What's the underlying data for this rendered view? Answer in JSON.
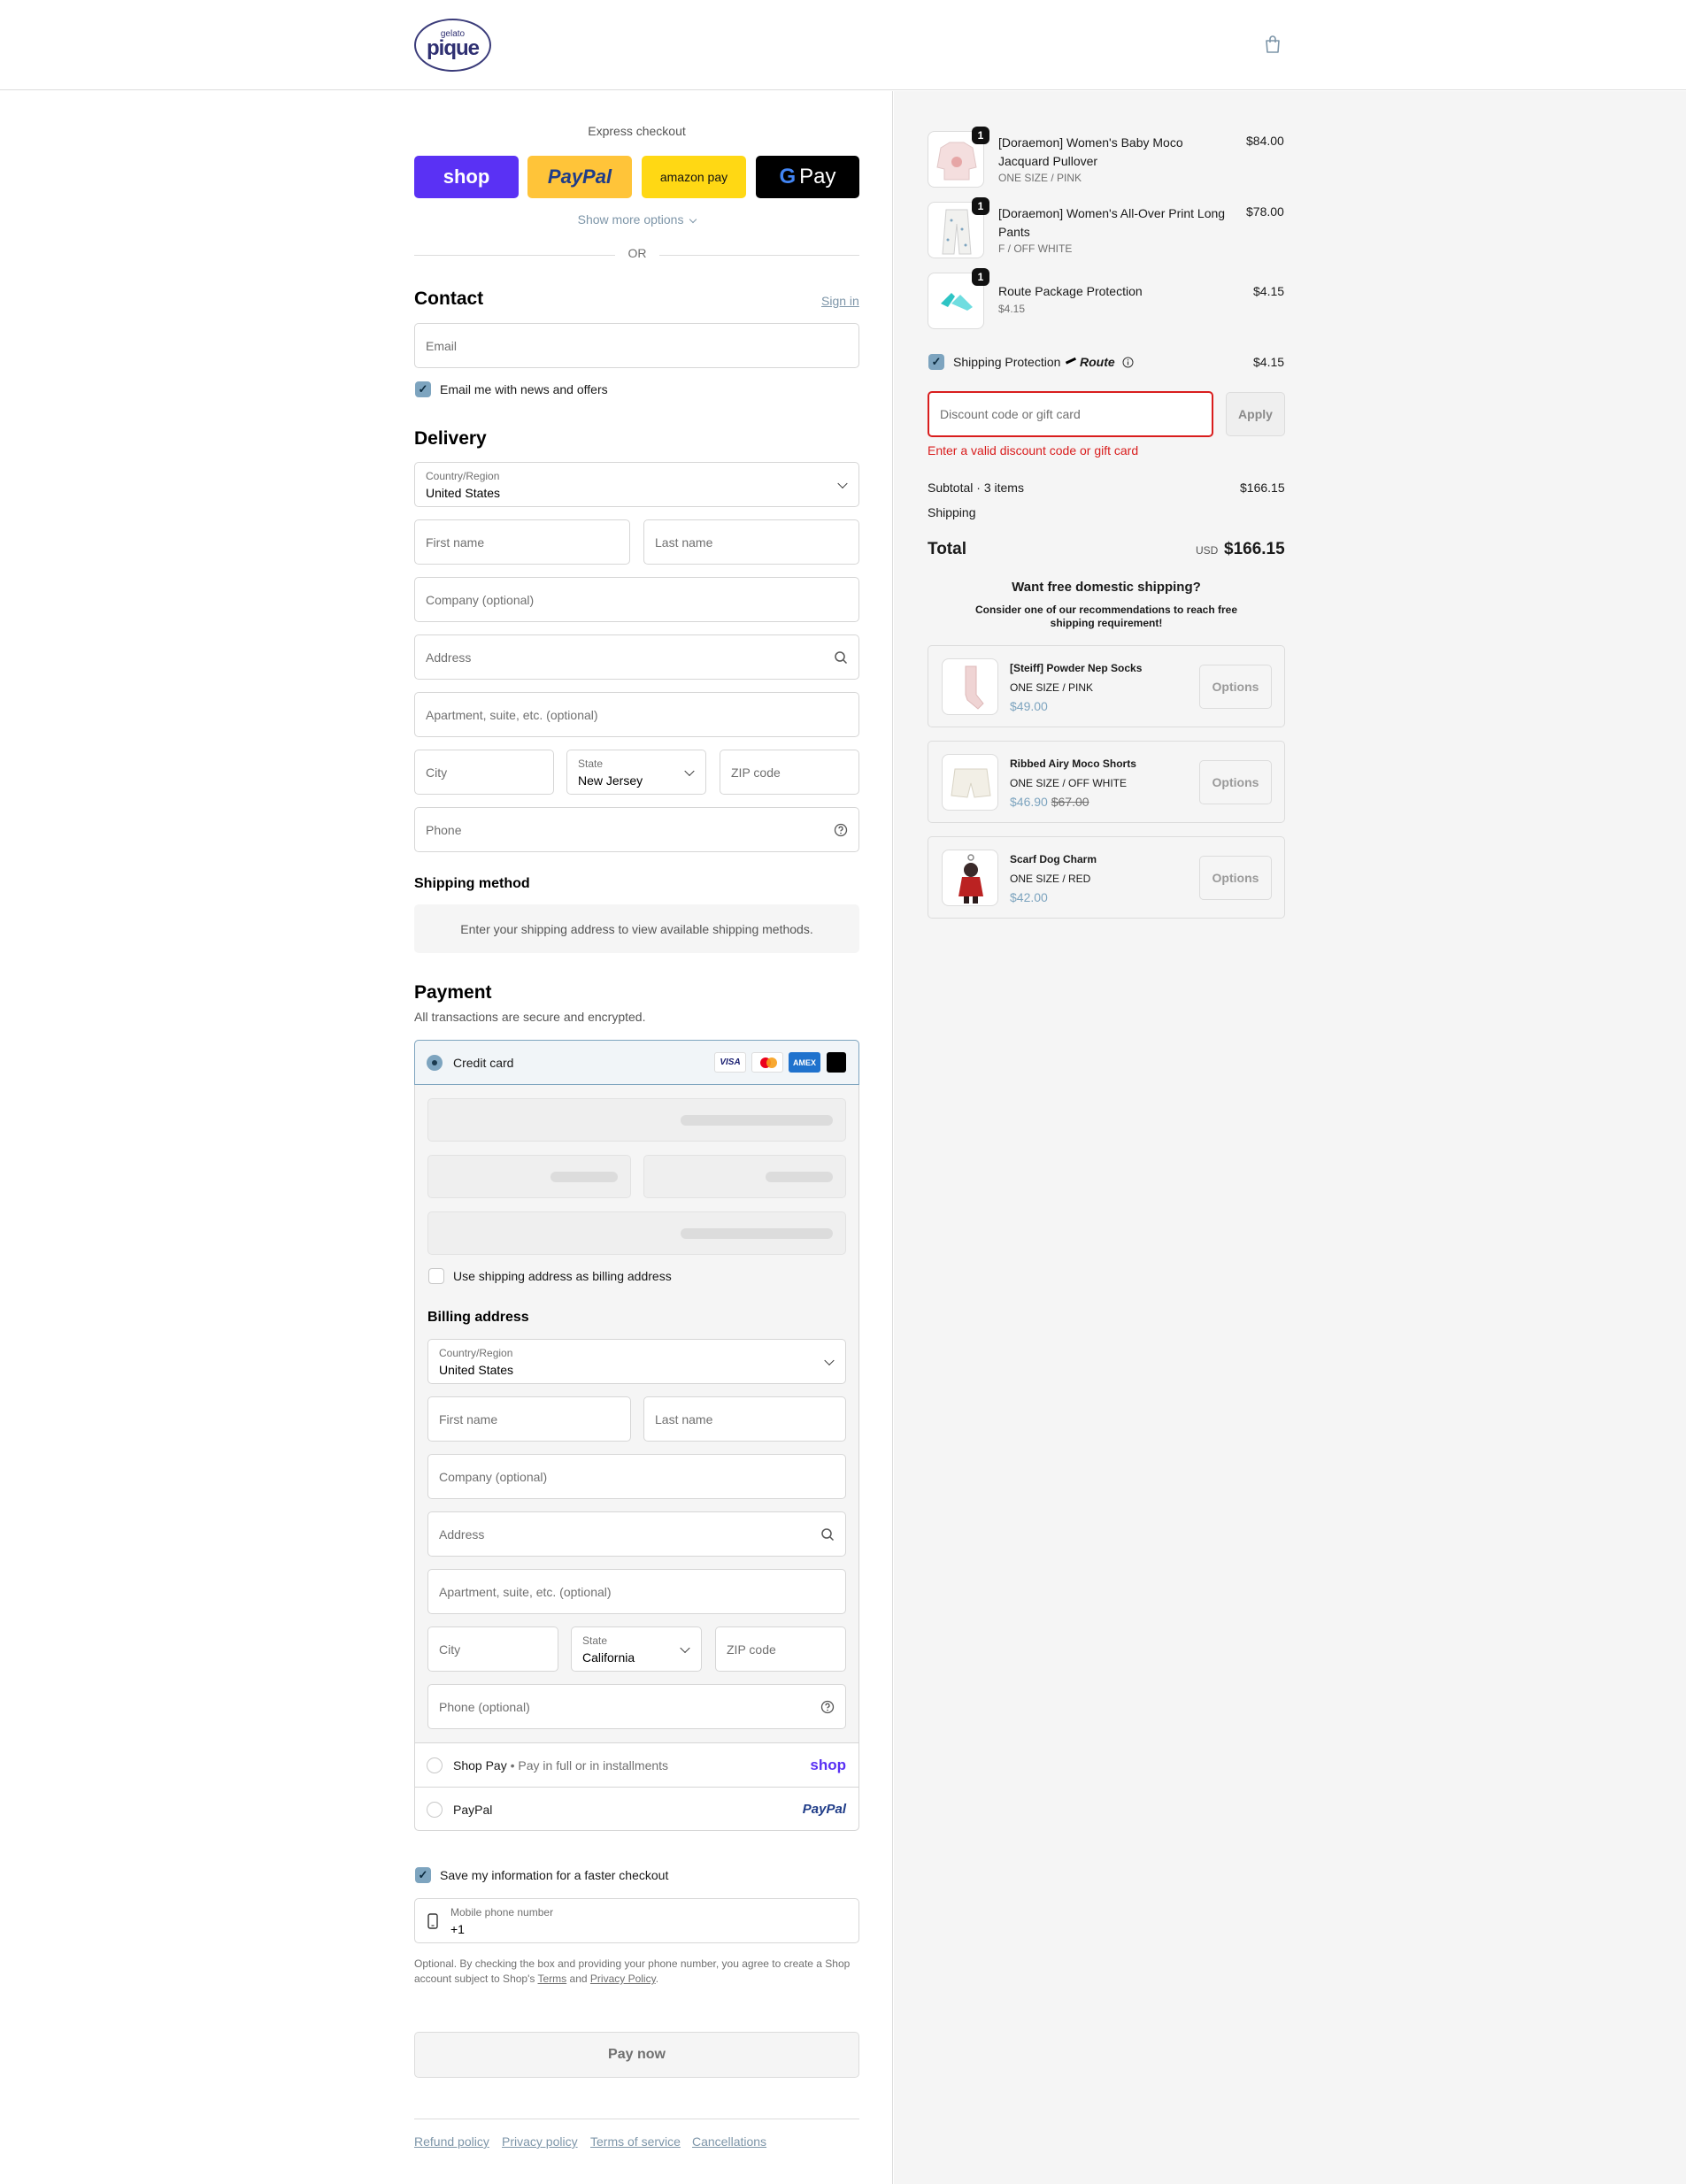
{
  "brand": {
    "logo_small": "gelato",
    "logo_big": "pique"
  },
  "express": {
    "title": "Express checkout",
    "shop": "shop",
    "paypal": "PayPal",
    "amazon": "amazon pay",
    "gpay": "Pay",
    "show_more": "Show more options",
    "or": "OR"
  },
  "contact": {
    "title": "Contact",
    "sign_in": "Sign in",
    "email_placeholder": "Email",
    "news_label": "Email me with news and offers"
  },
  "delivery": {
    "title": "Delivery",
    "country_label": "Country/Region",
    "country_value": "United States",
    "first_name": "First name",
    "last_name": "Last name",
    "company": "Company (optional)",
    "address": "Address",
    "apartment": "Apartment, suite, etc. (optional)",
    "city": "City",
    "state_label": "State",
    "state_value": "New Jersey",
    "zip": "ZIP code",
    "phone": "Phone"
  },
  "shipping_method": {
    "title": "Shipping method",
    "message": "Enter your shipping address to view available shipping methods."
  },
  "payment": {
    "title": "Payment",
    "subtitle": "All transactions are secure and encrypted.",
    "credit_card": "Credit card",
    "visa": "VISA",
    "amex": "AMEX",
    "use_shipping": "Use shipping address as billing address",
    "billing_title": "Billing address",
    "country_label": "Country/Region",
    "country_value": "United States",
    "first_name": "First name",
    "last_name": "Last name",
    "company": "Company (optional)",
    "address": "Address",
    "apartment": "Apartment, suite, etc. (optional)",
    "city": "City",
    "state_label": "State",
    "state_value": "California",
    "zip": "ZIP code",
    "phone": "Phone (optional)",
    "shop_pay": "Shop Pay",
    "shop_pay_sub": "• Pay in full or in installments",
    "shop_logo": "shop",
    "paypal": "PayPal",
    "paypal_logo": "PayPal"
  },
  "save_info": {
    "label": "Save my information for a faster checkout",
    "mobile_label": "Mobile phone number",
    "mobile_value": "+1",
    "legal_1": "Optional. By checking the box and providing your phone number, you agree to create a Shop",
    "legal_2": "account subject to Shop's",
    "terms": "Terms",
    "and": "and",
    "privacy": "Privacy Policy",
    "period": "."
  },
  "pay_now": "Pay now",
  "footer_links": [
    "Refund policy",
    "Privacy policy",
    "Terms of service",
    "Cancellations"
  ],
  "cart": {
    "items": [
      {
        "qty": "1",
        "name_1": "[Doraemon] Women's Baby Moco",
        "name_2": "Jacquard Pullover",
        "variant": "ONE SIZE / PINK",
        "price": "$84.00"
      },
      {
        "qty": "1",
        "name_1": "[Doraemon] Women's All-Over Print Long",
        "name_2": "Pants",
        "variant": "F / OFF WHITE",
        "price": "$78.00"
      },
      {
        "qty": "1",
        "name_1": "Route Package Protection",
        "name_2": "",
        "variant": "$4.15",
        "price": "$4.15"
      }
    ],
    "shipping_protection": "Shipping Protection",
    "route_logo": "Route",
    "shipping_protection_price": "$4.15",
    "discount_placeholder": "Discount code or gift card",
    "apply": "Apply",
    "discount_error": "Enter a valid discount code or gift card",
    "subtotal_label": "Subtotal · 3 items",
    "subtotal_value": "$166.15",
    "shipping_label": "Shipping",
    "total_label": "Total",
    "currency": "USD",
    "total_value": "$166.15"
  },
  "recommendations": {
    "title": "Want free domestic shipping?",
    "subtitle_1": "Consider one of our recommendations to reach free",
    "subtitle_2": "shipping requirement!",
    "items": [
      {
        "name": "[Steiff] Powder Nep Socks",
        "variant": "ONE SIZE / PINK",
        "price": "$49.00",
        "compare": "",
        "button": "Options"
      },
      {
        "name": "Ribbed Airy Moco Shorts",
        "variant": "ONE SIZE / OFF WHITE",
        "price": "$46.90",
        "compare": "$67.00",
        "button": "Options"
      },
      {
        "name": "Scarf Dog Charm",
        "variant": "ONE SIZE / RED",
        "price": "$42.00",
        "compare": "",
        "button": "Options"
      }
    ]
  },
  "colors": {
    "shop_purple": "#5a31f4",
    "paypal_yellow": "#ffc439",
    "amazon_yellow": "#ffd814",
    "accent_checkbox": "#7da4bf",
    "error_red": "#d91d1d"
  }
}
